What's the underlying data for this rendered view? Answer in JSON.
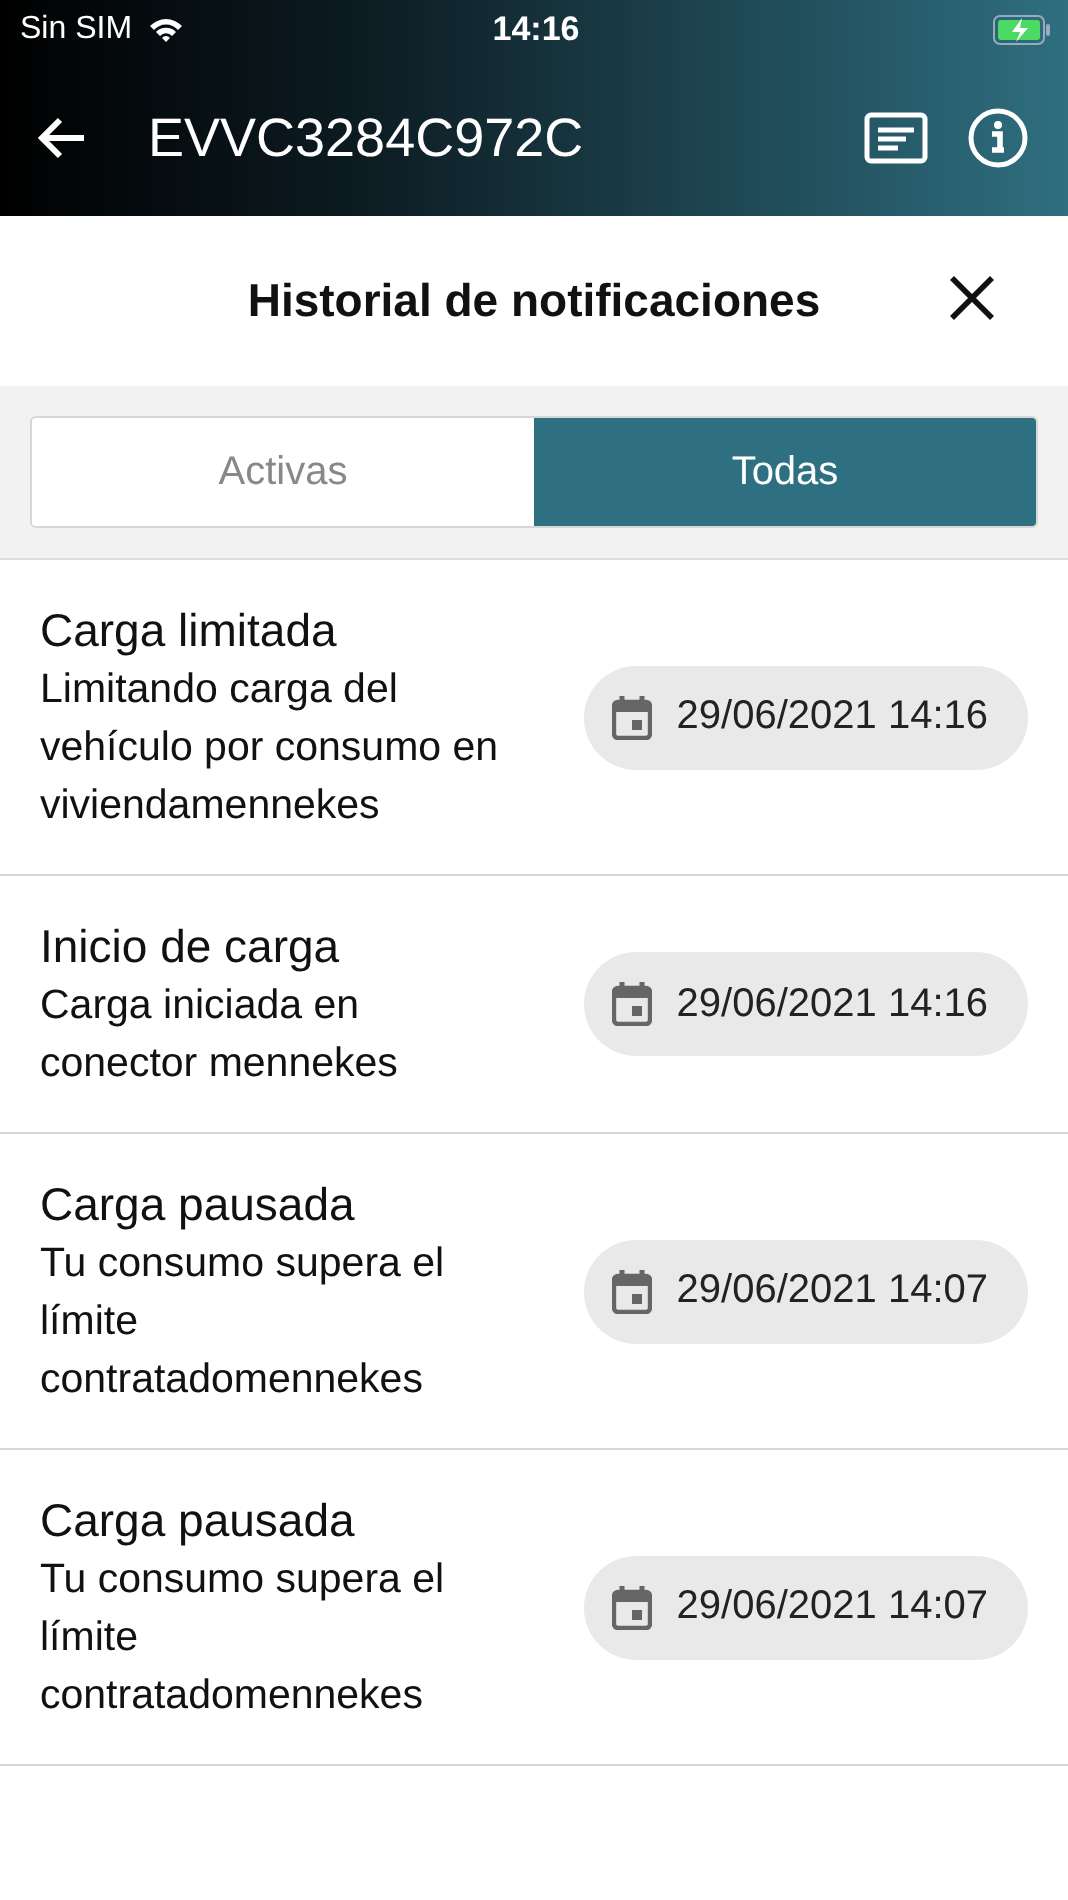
{
  "status_bar": {
    "carrier": "Sin SIM",
    "time": "14:16"
  },
  "header": {
    "title": "EVVC3284C972C"
  },
  "sheet": {
    "title": "Historial de notificaciones"
  },
  "tabs": [
    {
      "label": "Activas",
      "selected": false
    },
    {
      "label": "Todas",
      "selected": true
    }
  ],
  "notifications": [
    {
      "title": "Carga limitada",
      "message": "Limitando carga del vehículo por consumo en viviendamennekes",
      "date": "29/06/2021 14:16"
    },
    {
      "title": "Inicio de carga",
      "message": "Carga iniciada en conector mennekes",
      "date": "29/06/2021 14:16"
    },
    {
      "title": "Carga pausada",
      "message": "Tu consumo supera el límite contratadomennekes",
      "date": "29/06/2021 14:07"
    },
    {
      "title": "Carga pausada",
      "message": "Tu consumo supera el límite contratadomennekes",
      "date": "29/06/2021 14:07"
    }
  ]
}
